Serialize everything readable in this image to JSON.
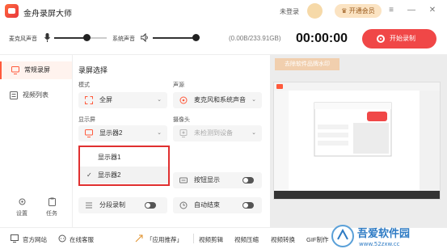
{
  "app": {
    "title": "金舟录屏大师",
    "login_status": "未登录",
    "vip_label": "开通会员"
  },
  "window_controls": {
    "menu": "≡",
    "minimize": "—",
    "close": "✕"
  },
  "toolbar": {
    "mic_label": "麦克风声音",
    "system_label": "系统声音",
    "mic_level": 0.62,
    "system_level": 0.92,
    "disk_usage": "(0.00B/233.91GB)",
    "timer": "00:00:00",
    "record_label": "开始录制"
  },
  "sidebar": {
    "items": [
      {
        "label": "常规录屏",
        "icon": "monitor-icon",
        "active": true
      },
      {
        "label": "视频列表",
        "icon": "list-icon",
        "active": false
      }
    ],
    "settings_label": "设置",
    "tasks_label": "任务"
  },
  "panel": {
    "section_title": "录屏选择",
    "mode": {
      "label": "模式",
      "value": "全屏"
    },
    "audio_source": {
      "label": "声源",
      "value": "麦克风和系统声音"
    },
    "display": {
      "label": "显示屏",
      "value": "显示器2"
    },
    "camera": {
      "label": "摄像头",
      "value": "未检测到设备"
    },
    "key_display": {
      "label": "按钮显示",
      "on": false
    },
    "segment_record": {
      "label": "分段录制",
      "on": false
    },
    "auto_end": {
      "label": "自动结束",
      "on": false
    }
  },
  "display_dropdown": {
    "options": [
      {
        "label": "显示器1",
        "selected": false
      },
      {
        "label": "显示器2",
        "selected": true
      }
    ],
    "check_mark": "✓"
  },
  "preview": {
    "watermark_button": "去除软件品牌水印"
  },
  "footer": {
    "links": [
      "官方网站",
      "在线客服",
      "「应用推荐」",
      "视频剪辑",
      "视频压缩",
      "视频转换",
      "GIF制作"
    ]
  },
  "site_watermark": {
    "text": "吾爱软件园",
    "url": "www.52zxw.cc"
  },
  "colors": {
    "accent": "#f04747",
    "vip_bg": "#fbe3c2",
    "highlight_border": "#e03030"
  }
}
